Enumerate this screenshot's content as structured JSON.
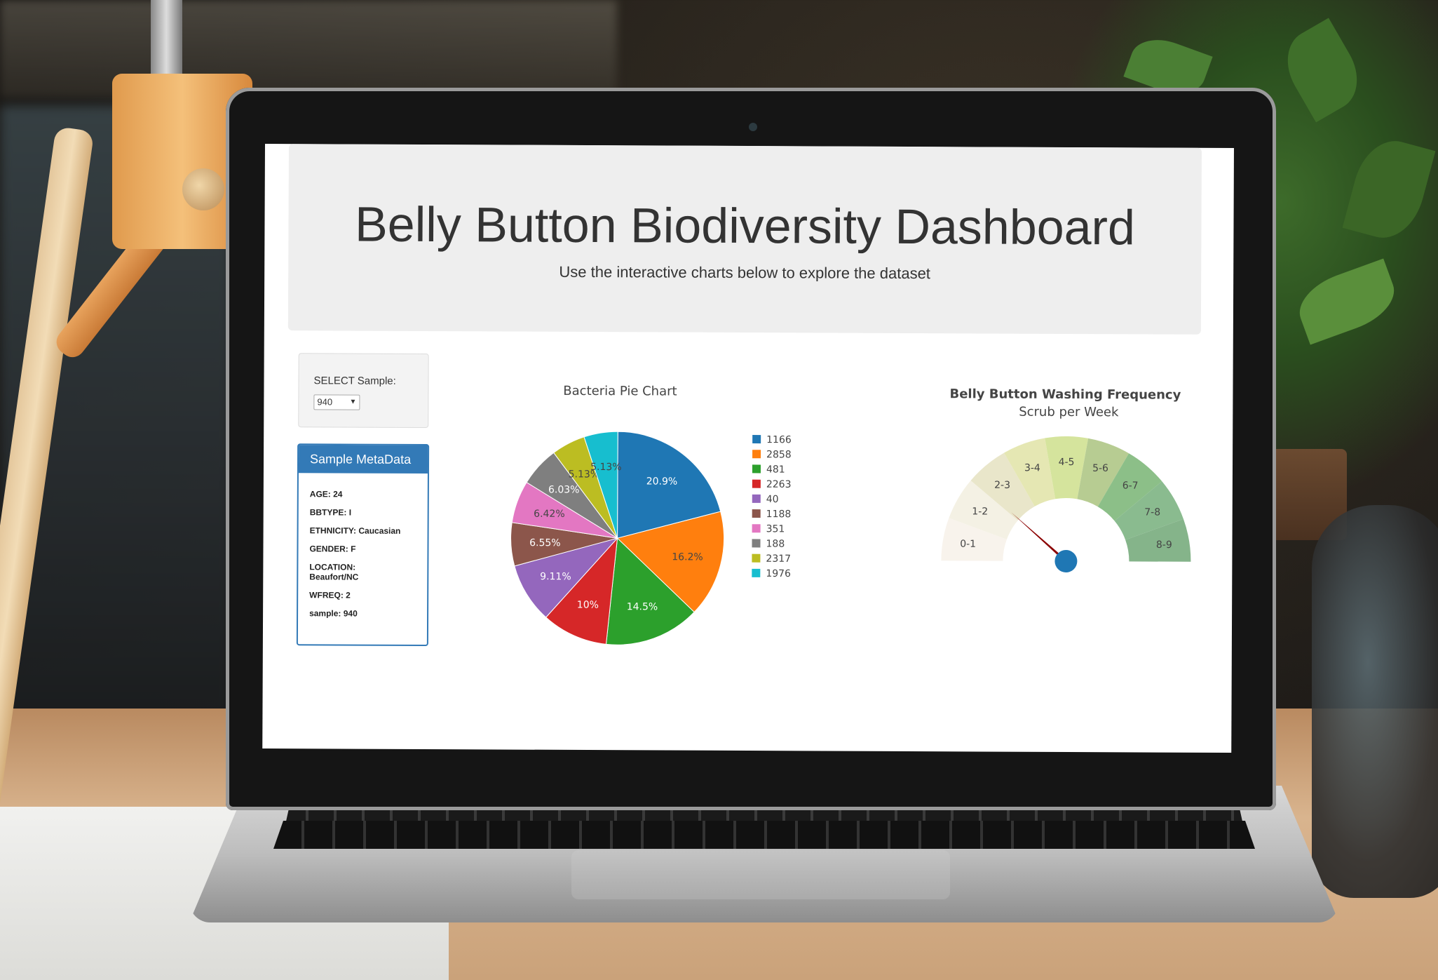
{
  "dashboard": {
    "title": "Belly Button Biodiversity Dashboard",
    "subtitle": "Use the interactive charts below to explore the dataset",
    "select_label": "SELECT Sample:",
    "select_value": "940",
    "metadata_header": "Sample MetaData",
    "metadata": [
      "AGE: 24",
      "BBTYPE: I",
      "ETHNICITY: Caucasian",
      "GENDER: F",
      "LOCATION: Beaufort/NC",
      "WFREQ: 2",
      "sample: 940"
    ]
  },
  "chart_data": [
    {
      "type": "pie",
      "title": "Bacteria Pie Chart",
      "labels": [
        "1166",
        "2858",
        "481",
        "2263",
        "40",
        "1188",
        "351",
        "188",
        "2317",
        "1976"
      ],
      "values": [
        20.9,
        16.2,
        14.5,
        10,
        9.11,
        6.55,
        6.42,
        6.03,
        5.13,
        5.13
      ],
      "value_labels": [
        "20.9%",
        "16.2%",
        "14.5%",
        "10%",
        "9.11%",
        "6.55%",
        "6.42%",
        "6.03%",
        "5.13%",
        "5.13%"
      ],
      "colors": [
        "#1f77b4",
        "#ff7f0e",
        "#2ca02c",
        "#d62728",
        "#9467bd",
        "#8c564b",
        "#e377c2",
        "#7f7f7f",
        "#bcbd22",
        "#17becf"
      ],
      "legend": "right"
    },
    {
      "type": "gauge",
      "title": "Belly Button Washing Frequency",
      "subtitle": "Scrub per Week",
      "categories": [
        "0-1",
        "1-2",
        "2-3",
        "3-4",
        "4-5",
        "5-6",
        "6-7",
        "7-8",
        "8-9"
      ],
      "colors": [
        "#f8f3ec",
        "#f4f1e4",
        "#e9e6ca",
        "#e5e7b3",
        "#d5e49d",
        "#b7cc92",
        "#8cbf88",
        "#8abb8f",
        "#85b48a"
      ],
      "value": 2,
      "range": [
        0,
        9
      ]
    }
  ]
}
